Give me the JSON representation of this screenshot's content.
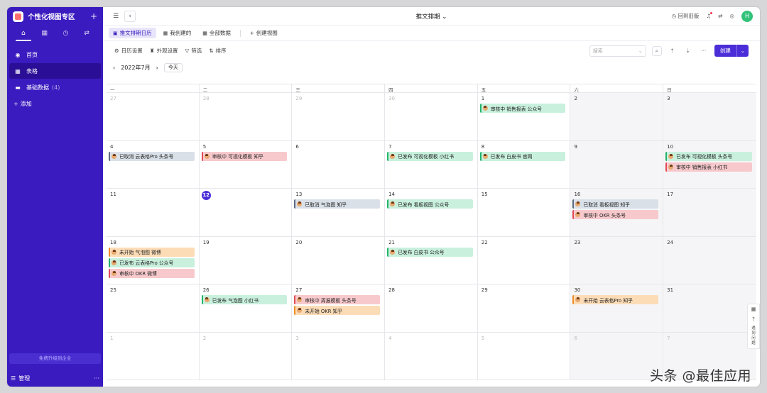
{
  "sidebar": {
    "title": "个性化视图专区",
    "add_symbol": "+",
    "tabs": [
      {
        "icon": "home-icon",
        "glyph": "⌂"
      },
      {
        "icon": "grid-icon",
        "glyph": "▦"
      },
      {
        "icon": "clock-icon",
        "glyph": "◷"
      },
      {
        "icon": "flow-icon",
        "glyph": "⇄"
      }
    ],
    "items": [
      {
        "label": "首页",
        "icon": "home-circle-icon",
        "glyph": "◉"
      },
      {
        "label": "表格",
        "icon": "table-icon",
        "glyph": "▦"
      },
      {
        "label": "基础数据",
        "count": "(4)",
        "icon": "folder-icon",
        "glyph": "▬"
      },
      {
        "label": "添加",
        "icon": "plus-icon",
        "glyph": "+"
      }
    ],
    "upgrade": "免费升级到企业",
    "manage": "管理",
    "more": "···"
  },
  "topbar": {
    "title": "推文排期",
    "title_arrow": "⌄",
    "back_to_old": "回到旧版"
  },
  "view_tabs": [
    {
      "label": "推文排期日历",
      "active": true,
      "glyph": "▣"
    },
    {
      "label": "我创建的",
      "active": false,
      "glyph": "▦"
    },
    {
      "label": "全部数据",
      "active": false,
      "glyph": "▦"
    }
  ],
  "new_view": "创建视图",
  "toolbar": {
    "calendar_settings": "日历设置",
    "appearance_settings": "外观设置",
    "filter": "筛选",
    "sort": "排序",
    "search_placeholder": "搜索",
    "create": "创建"
  },
  "nav": {
    "month": "2022年7月",
    "today": "今天"
  },
  "weekdays": [
    "一",
    "二",
    "三",
    "四",
    "五",
    "六",
    "日"
  ],
  "weeks": [
    [
      {
        "day": "27",
        "other": true,
        "events": []
      },
      {
        "day": "28",
        "other": true,
        "events": []
      },
      {
        "day": "29",
        "other": true,
        "events": []
      },
      {
        "day": "30",
        "other": true,
        "events": []
      },
      {
        "day": "1",
        "events": [
          {
            "text": "审核中 销售报表 公众号",
            "color": "green"
          }
        ]
      },
      {
        "day": "2",
        "events": []
      },
      {
        "day": "3",
        "events": []
      }
    ],
    [
      {
        "day": "4",
        "events": [
          {
            "text": "已取消 云表格Pro 头条号",
            "color": "gray"
          }
        ]
      },
      {
        "day": "5",
        "events": [
          {
            "text": "审核中 可视化模板 知乎",
            "color": "red"
          }
        ]
      },
      {
        "day": "6",
        "events": []
      },
      {
        "day": "7",
        "events": [
          {
            "text": "已发布 可视化模板 小红书",
            "color": "green"
          }
        ]
      },
      {
        "day": "8",
        "events": [
          {
            "text": "已发布 白皮书 官网",
            "color": "green"
          }
        ]
      },
      {
        "day": "9",
        "events": []
      },
      {
        "day": "10",
        "events": [
          {
            "text": "已发布 可视化模板 头条号",
            "color": "green"
          },
          {
            "text": "审核中 销售报表 小红书",
            "color": "red"
          }
        ]
      }
    ],
    [
      {
        "day": "11",
        "events": []
      },
      {
        "day": "12",
        "today": true,
        "events": []
      },
      {
        "day": "13",
        "events": [
          {
            "text": "已取消 气泡图 知乎",
            "color": "gray"
          }
        ]
      },
      {
        "day": "14",
        "events": [
          {
            "text": "已发布 看板视图 公众号",
            "color": "green"
          }
        ]
      },
      {
        "day": "15",
        "events": []
      },
      {
        "day": "16",
        "events": [
          {
            "text": "已取消 看板视图 知乎",
            "color": "gray"
          },
          {
            "text": "审核中 OKR 头条号",
            "color": "red"
          }
        ]
      },
      {
        "day": "17",
        "events": []
      }
    ],
    [
      {
        "day": "18",
        "events": [
          {
            "text": "未开始 气泡图 微博",
            "color": "orange"
          },
          {
            "text": "已发布 云表格Pro 公众号",
            "color": "green"
          },
          {
            "text": "审核中 OKR 微博",
            "color": "red"
          }
        ]
      },
      {
        "day": "19",
        "events": []
      },
      {
        "day": "20",
        "events": []
      },
      {
        "day": "21",
        "events": [
          {
            "text": "已发布 白皮书 公众号",
            "color": "green"
          }
        ]
      },
      {
        "day": "22",
        "events": []
      },
      {
        "day": "23",
        "events": []
      },
      {
        "day": "24",
        "events": []
      }
    ],
    [
      {
        "day": "25",
        "events": []
      },
      {
        "day": "26",
        "events": [
          {
            "text": "已发布 气泡图 小红书",
            "color": "green"
          }
        ]
      },
      {
        "day": "27",
        "events": [
          {
            "text": "审核中 周报模板 头条号",
            "color": "red"
          },
          {
            "text": "未开始 OKR 知乎",
            "color": "orange"
          }
        ]
      },
      {
        "day": "28",
        "events": []
      },
      {
        "day": "29",
        "events": []
      },
      {
        "day": "30",
        "events": [
          {
            "text": "未开始 云表格Pro 知乎",
            "color": "orange"
          }
        ]
      },
      {
        "day": "31",
        "events": []
      }
    ],
    [
      {
        "day": "1",
        "other": true,
        "events": []
      },
      {
        "day": "2",
        "other": true,
        "events": []
      },
      {
        "day": "3",
        "other": true,
        "events": []
      },
      {
        "day": "4",
        "other": true,
        "events": []
      },
      {
        "day": "5",
        "other": true,
        "events": []
      },
      {
        "day": "6",
        "other": true,
        "events": []
      },
      {
        "day": "7",
        "other": true,
        "events": []
      }
    ]
  ],
  "float": {
    "qr": "▦",
    "help_glyph": "?",
    "help_label": "遇到问题"
  },
  "watermark": "头条 @最佳应用",
  "colors": {
    "accent": "#4b2ed8",
    "sidebar": "#3a1bbf",
    "green": "#c8f0dd",
    "red": "#f7c9cc",
    "gray": "#d9e0e8",
    "orange": "#fcdcb7"
  }
}
